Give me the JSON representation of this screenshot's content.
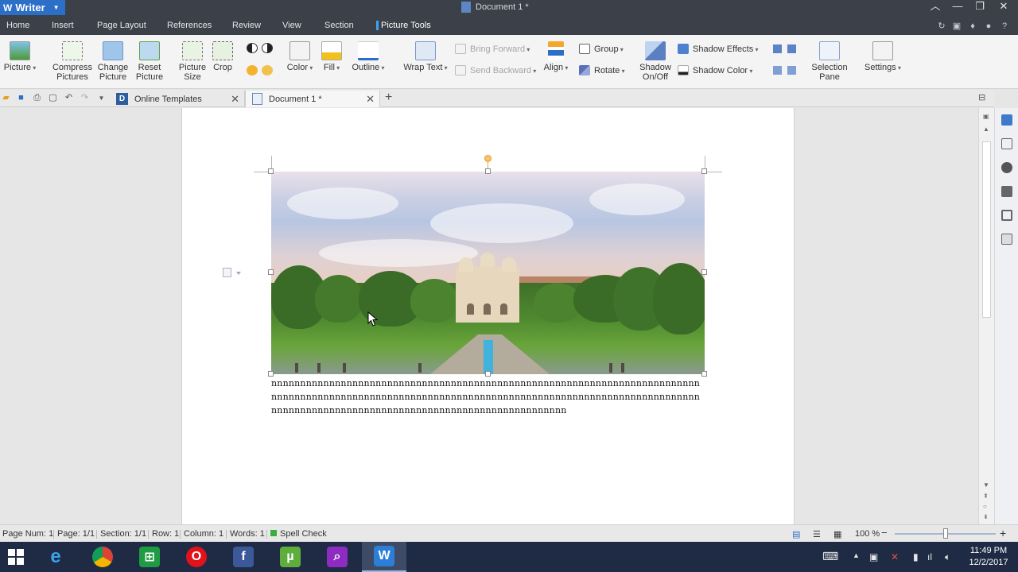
{
  "window": {
    "app_name": "Writer",
    "doc_title": "Document 1 *"
  },
  "menu_tabs": [
    "Home",
    "Insert",
    "Page Layout",
    "References",
    "Review",
    "View",
    "Section",
    "Picture Tools"
  ],
  "ribbon": {
    "picture": "Picture",
    "compress_1": "Compress",
    "compress_2": "Pictures",
    "change_1": "Change",
    "change_2": "Picture",
    "reset_1": "Reset",
    "reset_2": "Picture",
    "size_1": "Picture",
    "size_2": "Size",
    "crop": "Crop",
    "color": "Color",
    "fill": "Fill",
    "outline": "Outline",
    "wrap_text": "Wrap Text",
    "bring_forward": "Bring Forward",
    "send_backward": "Send Backward",
    "align": "Align",
    "group": "Group",
    "rotate": "Rotate",
    "shadow_1": "Shadow",
    "shadow_2": "On/Off",
    "shadow_effects": "Shadow Effects",
    "shadow_color": "Shadow Color",
    "selection_1": "Selection",
    "selection_2": "Pane",
    "settings": "Settings"
  },
  "doc_tabs": {
    "online": "Online Templates",
    "document": "Document 1 *"
  },
  "document": {
    "body_text": "nnnnnnnnnnnnnnnnnnnnnnnnnnnnnnnnnnnnnnnnnnnnnnnnnnnnnnnnnnnnnnnnnnnnnnnnnnnnnnnnnnnnnnnnnnnnnnnnnnnnnnnnnnnnnnnnnnnnnnnnnnnnnnnnnnnnnnnnnnnnnnnnnnnnnnnnnnnnnnnnnnnnnnnnnnnnnnnnnnnnnnnnnnnnnnnnnnnnnnn"
  },
  "status": {
    "page_num": "Page Num: 1",
    "page": "Page: 1/1",
    "section": "Section: 1/1",
    "row": "Row: 1",
    "column": "Column: 1",
    "words": "Words: 1",
    "spell_check": "Spell Check",
    "zoom": "100 %"
  },
  "taskbar": {
    "time": "11:49 PM",
    "date": "12/2/2017"
  },
  "colors": {
    "accent": "#2b6fc6",
    "title_bar": "#3c4149",
    "taskbar": "#1f2a44"
  }
}
